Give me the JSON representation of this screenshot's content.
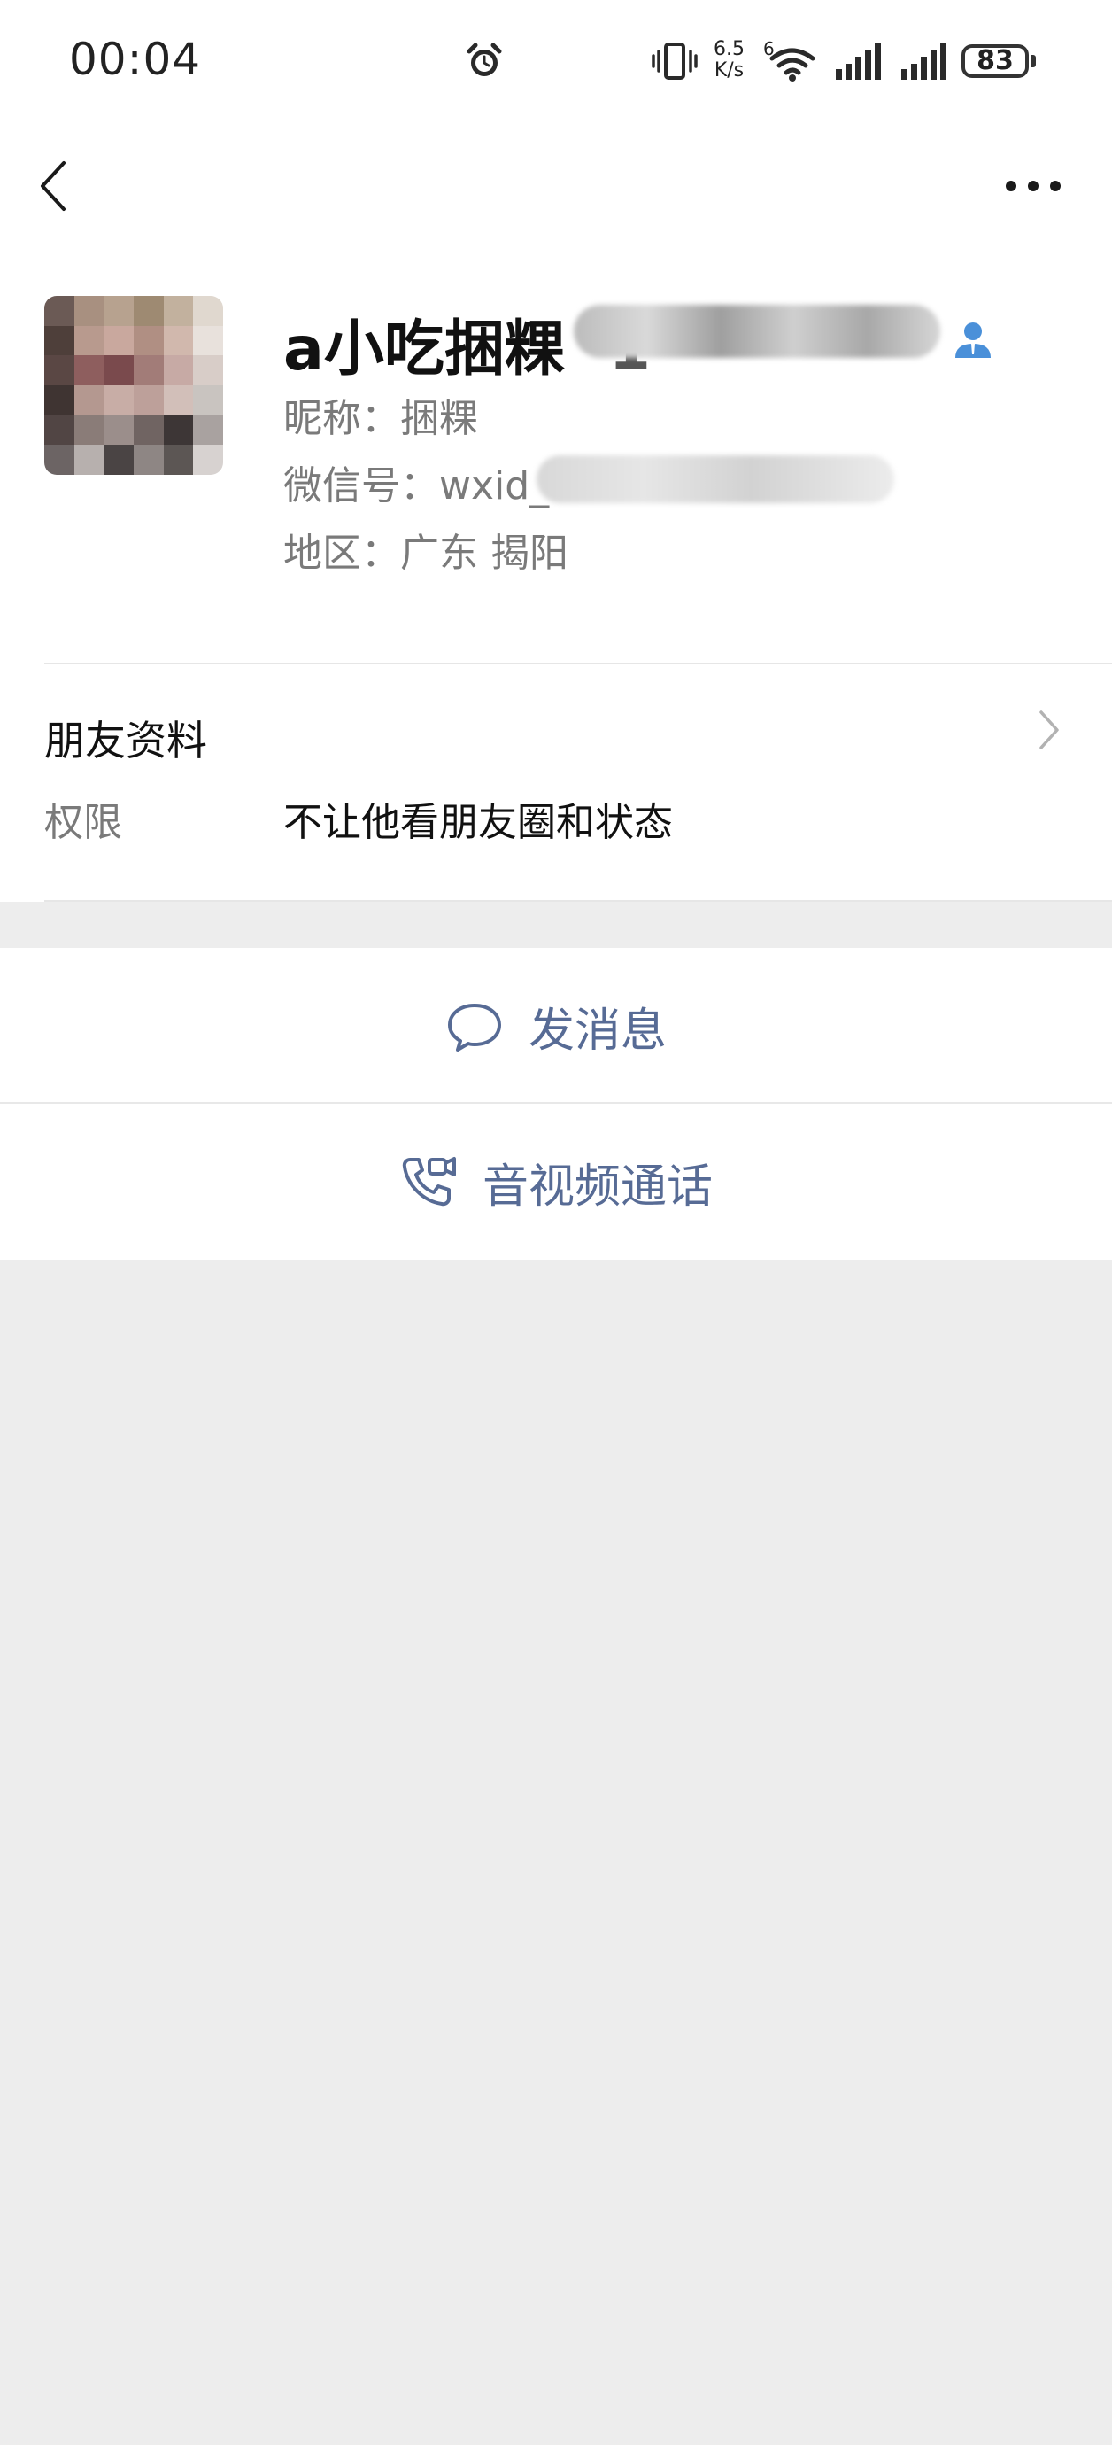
{
  "status_bar": {
    "time": "00:04",
    "net_speed_value": "6.5",
    "net_speed_unit": "K/s",
    "network_type": "6",
    "battery": "83",
    "icons": [
      "alarm-icon",
      "vibrate-icon",
      "wifi-icon",
      "signal-icon",
      "signal-icon",
      "battery-icon"
    ]
  },
  "nav": {
    "back_icon": "chevron-left-icon",
    "more_icon": "more-dots-icon"
  },
  "profile": {
    "name": "a小吃捆粿",
    "name_suffix_partial": "1",
    "nickname": "昵称：捆粿",
    "wechat_id": "微信号：wxid_",
    "region": "地区：广东  揭阳",
    "contact_icon": "person-icon"
  },
  "friend_info": {
    "title": "朋友资料",
    "permission_label": "权限",
    "permission_value": "不让他看朋友圈和状态"
  },
  "actions": {
    "message_label": "发消息",
    "call_label": "音视频通话"
  },
  "colors": {
    "link": "#576b95",
    "background": "#ededed",
    "card": "#ffffff"
  }
}
